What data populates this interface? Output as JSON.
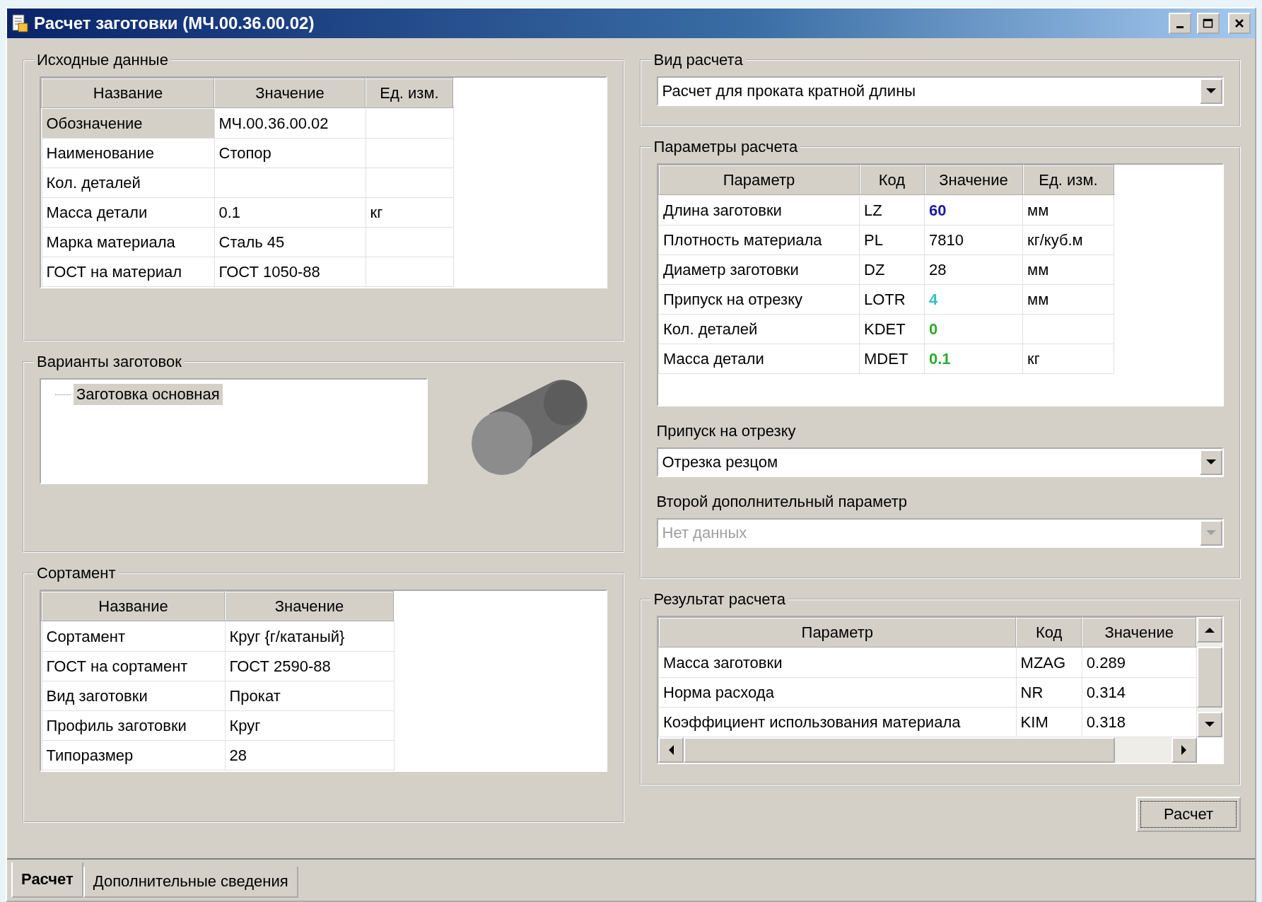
{
  "window": {
    "title": "Расчет заготовки (МЧ.00.36.00.02)"
  },
  "source_data": {
    "title": "Исходные данные",
    "columns": [
      "Название",
      "Значение",
      "Ед. изм."
    ],
    "rows": [
      {
        "cells": [
          "Обозначение",
          "МЧ.00.36.00.02",
          ""
        ],
        "selected": true
      },
      {
        "cells": [
          "Наименование",
          "Стопор",
          ""
        ],
        "selected": false
      },
      {
        "cells": [
          "Кол. деталей",
          "",
          ""
        ],
        "selected": false
      },
      {
        "cells": [
          "Масса детали",
          "0.1",
          "кг"
        ],
        "selected": false
      },
      {
        "cells": [
          "Марка материала",
          "Сталь 45",
          ""
        ],
        "selected": false
      },
      {
        "cells": [
          "ГОСТ на материал",
          "ГОСТ 1050-88",
          ""
        ],
        "selected": false
      }
    ]
  },
  "variants": {
    "title": "Варианты заготовок",
    "tree": [
      {
        "label": "Заготовка основная",
        "selected": true
      }
    ]
  },
  "sortament": {
    "title": "Сортамент",
    "columns": [
      "Название",
      "Значение"
    ],
    "rows": [
      {
        "cells": [
          "Сортамент",
          "Круг {г/катаный}"
        ]
      },
      {
        "cells": [
          "ГОСТ на сортамент",
          "ГОСТ 2590-88"
        ]
      },
      {
        "cells": [
          "Вид заготовки",
          "Прокат"
        ]
      },
      {
        "cells": [
          "Профиль заготовки",
          "Круг"
        ]
      },
      {
        "cells": [
          "Типоразмер",
          "28"
        ]
      }
    ]
  },
  "calc_type": {
    "title": "Вид расчета",
    "value": "Расчет для проката кратной  длины"
  },
  "params": {
    "title": "Параметры расчета",
    "columns": [
      "Параметр",
      "Код",
      "Значение",
      "Ед. изм."
    ],
    "rows": [
      {
        "cells": [
          "Длина заготовки",
          "LZ",
          "60",
          "мм"
        ],
        "color": "#1a1aa0"
      },
      {
        "cells": [
          "Плотность материала",
          "PL",
          "7810",
          "кг/куб.м"
        ]
      },
      {
        "cells": [
          "Диаметр заготовки",
          "DZ",
          "28",
          "мм"
        ]
      },
      {
        "cells": [
          "Припуск на отрезку",
          "LOTR",
          "4",
          "мм"
        ],
        "color": "#33c0c8"
      },
      {
        "cells": [
          "Кол. деталей",
          "KDET",
          "0",
          ""
        ],
        "color": "#2eaa2e"
      },
      {
        "cells": [
          "Масса детали",
          "MDET",
          "0.1",
          "кг"
        ],
        "color": "#2eaa2e"
      }
    ],
    "fields": [
      {
        "label": "Припуск на отрезку",
        "value": "Отрезка резцом",
        "disabled": false
      },
      {
        "label": "Второй дополнительный параметр",
        "value": "Нет данных",
        "disabled": true
      }
    ]
  },
  "results": {
    "title": "Результат расчета",
    "columns": [
      "Параметр",
      "Код",
      "Значение"
    ],
    "rows": [
      {
        "cells": [
          "Масса заготовки",
          "MZAG",
          "0.289"
        ]
      },
      {
        "cells": [
          "Норма расхода",
          "NR",
          "0.314"
        ]
      },
      {
        "cells": [
          "Коэффициент использования материала",
          "KIM",
          "0.318"
        ]
      }
    ]
  },
  "calc_button": {
    "label": "Расчет"
  },
  "tabs": [
    {
      "label": "Расчет",
      "selected": true
    },
    {
      "label": "Дополнительные сведения",
      "selected": false
    }
  ]
}
